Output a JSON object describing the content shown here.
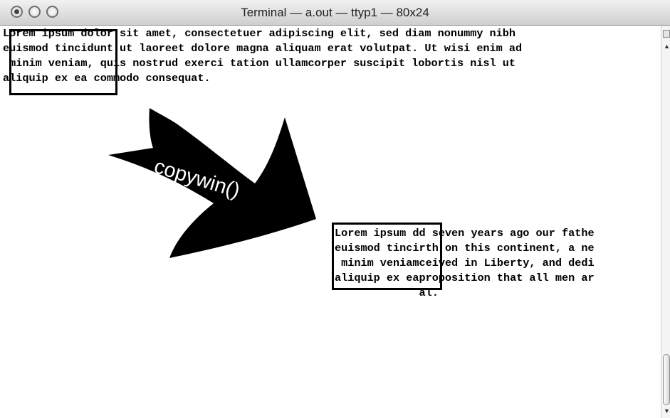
{
  "window": {
    "title": "Terminal — a.out — ttyp1 — 80x24"
  },
  "terminal": {
    "lines_top": [
      "Lorem ipsum dolor sit amet, consectetuer adipiscing elit, sed diam nonummy nibh",
      "euismod tincidunt ut laoreet dolore magna aliquam erat volutpat. Ut wisi enim ad",
      " minim veniam, quis nostrud exerci tation ullamcorper suscipit lobortis nisl ut",
      "aliquip ex ea commodo consequat."
    ],
    "lines_bottom": [
      "Lorem ipsum dd seven years ago our fathe",
      "euismod tincirth on this continent, a ne",
      " minim veniamceived in Liberty, and dedi",
      "aliquip ex eaproposition that all men ar",
      "             al."
    ]
  },
  "diagram": {
    "label": "copywin()",
    "arrow_color": "#000000",
    "label_color": "#ffffff"
  },
  "icons": {
    "close": "close-icon",
    "minimize": "minimize-icon",
    "zoom": "zoom-icon",
    "scroll_up": "up-arrow-icon",
    "scroll_down": "down-arrow-icon"
  }
}
